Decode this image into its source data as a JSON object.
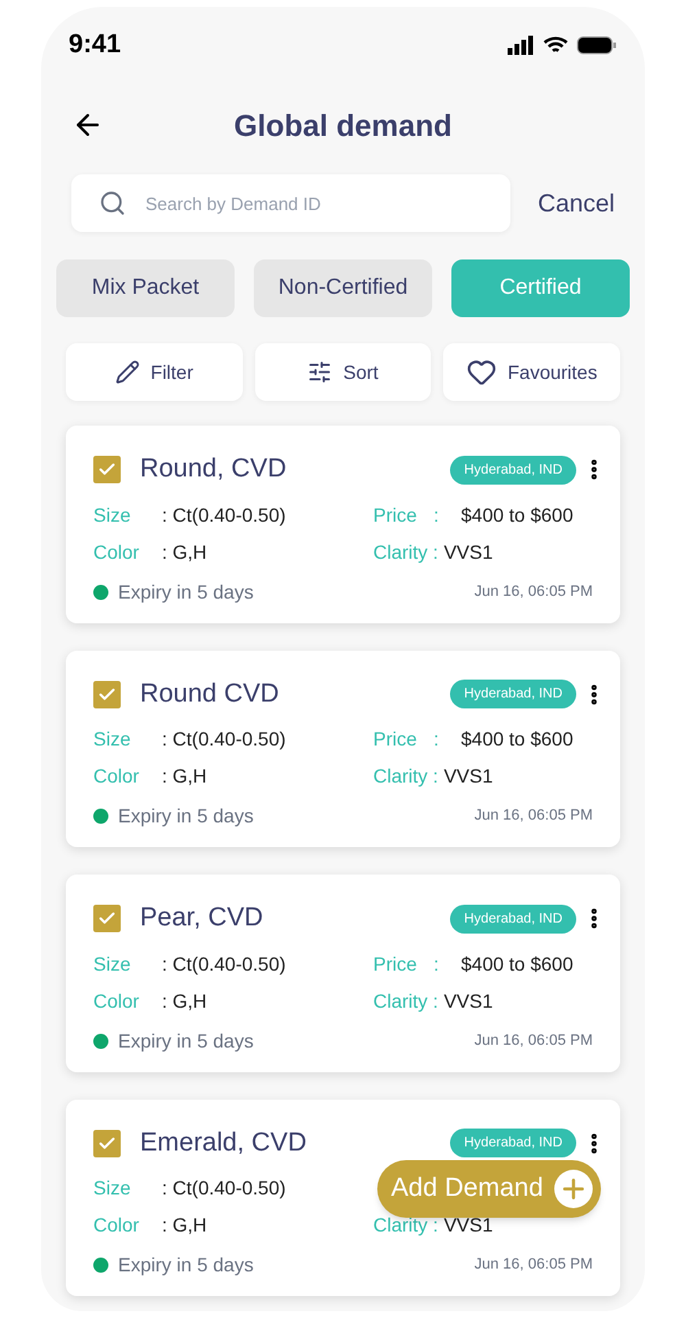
{
  "status_bar": {
    "time": "9:41"
  },
  "header": {
    "title": "Global demand"
  },
  "search": {
    "placeholder": "Search by Demand ID",
    "cancel": "Cancel"
  },
  "tabs": [
    {
      "label": "Mix Packet",
      "selected": false
    },
    {
      "label": "Non-Certified",
      "selected": false
    },
    {
      "label": "Certified",
      "selected": true
    }
  ],
  "actions": [
    {
      "kind": "filter",
      "label": "Filter"
    },
    {
      "kind": "sort",
      "label": "Sort"
    },
    {
      "kind": "favourite",
      "label": "Favourites"
    }
  ],
  "cards": [
    {
      "title": "Round, CVD",
      "checked": true,
      "location": "Hyderabad, IND",
      "size_label": "Size",
      "size": ": Ct(0.40-0.50)",
      "color_label": "Color",
      "gem_color": ": G,H",
      "price_label": "Price",
      "price_sep": ":",
      "price": "$400 to $600",
      "clarity_label": "Clarity :",
      "clarity": "VVS1",
      "expiry": "Expiry in 5 days",
      "date": "Jun 16, 06:05 PM"
    },
    {
      "title": "Round CVD",
      "checked": true,
      "location": "Hyderabad, IND",
      "size_label": "Size",
      "size": ": Ct(0.40-0.50)",
      "color_label": "Color",
      "gem_color": ": G,H",
      "price_label": "Price",
      "price_sep": ":",
      "price": "$400 to $600",
      "clarity_label": "Clarity :",
      "clarity": "VVS1",
      "expiry": "Expiry in 5 days",
      "date": "Jun 16, 06:05 PM"
    },
    {
      "title": "Pear, CVD",
      "checked": true,
      "location": "Hyderabad, IND",
      "size_label": "Size",
      "size": ": Ct(0.40-0.50)",
      "color_label": "Color",
      "gem_color": ": G,H",
      "price_label": "Price",
      "price_sep": ":",
      "price": "$400 to $600",
      "clarity_label": "Clarity :",
      "clarity": "VVS1",
      "expiry": "Expiry in 5 days",
      "date": "Jun 16, 06:05 PM"
    },
    {
      "title": "Emerald, CVD",
      "checked": true,
      "location": "Hyderabad, IND",
      "size_label": "Size",
      "size": ": Ct(0.40-0.50)",
      "color_label": "Color",
      "gem_color": ": G,H",
      "clarity_label": "Clarity :",
      "clarity": "VVS1",
      "expiry": "Expiry in 5 days",
      "date": "Jun 16, 06:05 PM"
    }
  ],
  "fab": {
    "label": "Add Demand"
  }
}
